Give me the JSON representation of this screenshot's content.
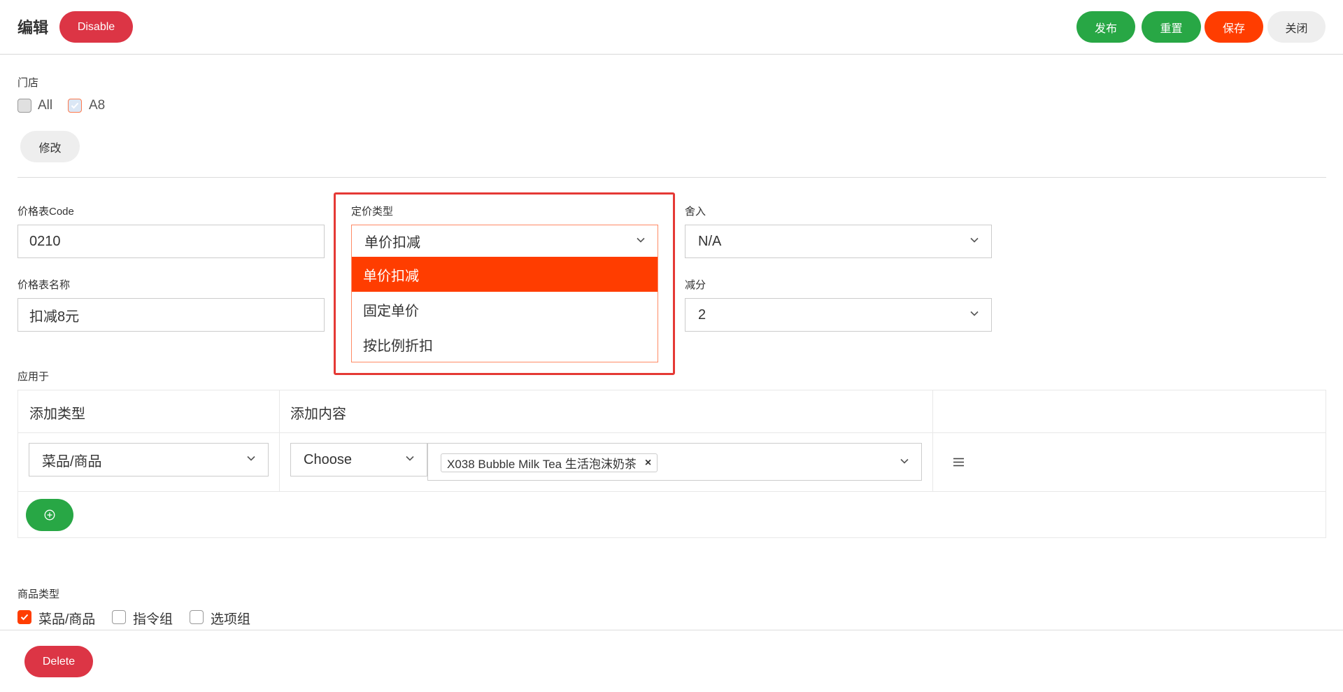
{
  "header": {
    "title": "编辑",
    "disable_label": "Disable",
    "publish_label": "发布",
    "reset_label": "重置",
    "save_label": "保存",
    "close_label": "关闭"
  },
  "store": {
    "label": "门店",
    "options": [
      {
        "label": "All",
        "checked": false
      },
      {
        "label": "A8",
        "checked": true
      }
    ],
    "modify_label": "修改"
  },
  "form": {
    "code_label": "价格表Code",
    "code_value": "0210",
    "name_label": "价格表名称",
    "name_value": "扣减8元",
    "pricing_type_label": "定价类型",
    "pricing_type_value": "单价扣减",
    "pricing_type_options": [
      "单价扣减",
      "固定单价",
      "按比例折扣"
    ],
    "rounding_label": "舍入",
    "rounding_value": "N/A",
    "decimal_label": "减分",
    "decimal_value": "2"
  },
  "apply_to": {
    "label": "应用于",
    "col_type": "添加类型",
    "col_content": "添加内容",
    "row": {
      "type_value": "菜品/商品",
      "choose_value": "Choose",
      "tag": "X038 Bubble Milk Tea 生活泡沫奶茶"
    }
  },
  "product_type": {
    "label": "商品类型",
    "options": [
      {
        "label": "菜品/商品",
        "checked": true
      },
      {
        "label": "指令组",
        "checked": false
      },
      {
        "label": "选项组",
        "checked": false
      }
    ]
  },
  "footer": {
    "delete_label": "Delete"
  },
  "colors": {
    "accent_orange": "#ff3d00",
    "green": "#28a745",
    "red": "#dc3545",
    "highlight_red": "#e53935"
  }
}
